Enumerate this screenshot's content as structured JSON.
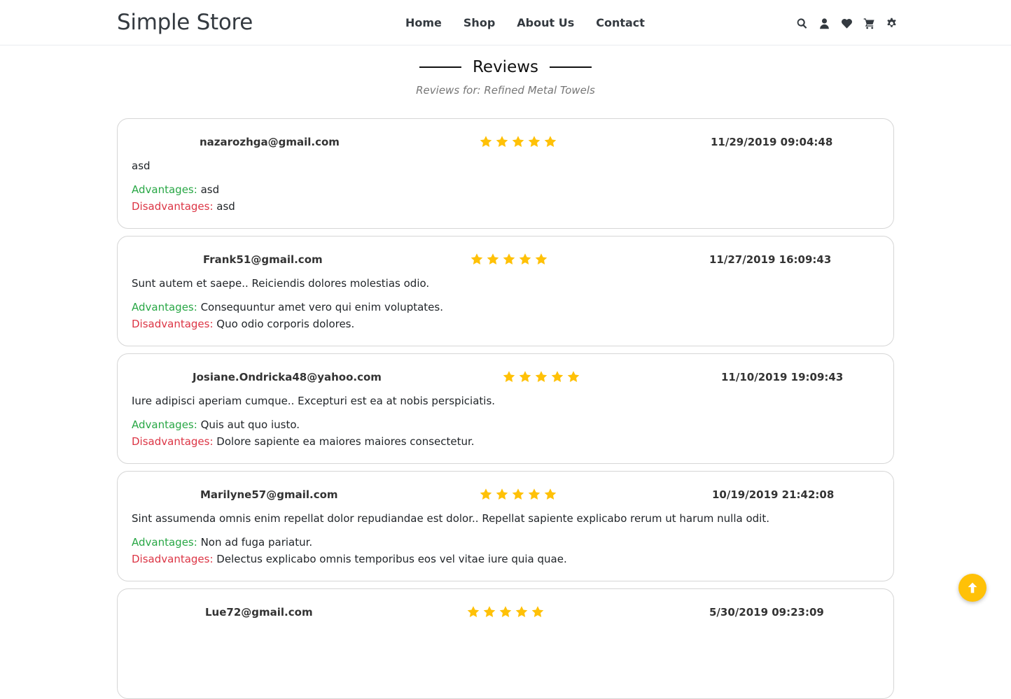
{
  "header": {
    "brand": "Simple Store",
    "nav": [
      "Home",
      "Shop",
      "About Us",
      "Contact"
    ],
    "icons": [
      "search-icon",
      "user-icon",
      "heart-icon",
      "cart-icon",
      "gear-icon"
    ]
  },
  "page": {
    "title": "Reviews",
    "subtitle": "Reviews for: Refined Metal Towels"
  },
  "labels": {
    "advantages": "Advantages:",
    "disadvantages": "Disadvantages:"
  },
  "colors": {
    "accent": "#ffc107",
    "advantages": "#28a745",
    "disadvantages": "#dc3545"
  },
  "reviews": [
    {
      "email": "nazarozhga@gmail.com",
      "rating": 5,
      "date": "11/29/2019 09:04:48",
      "text": "asd",
      "advantages": "asd",
      "disadvantages": "asd"
    },
    {
      "email": "Frank51@gmail.com",
      "rating": 5,
      "date": "11/27/2019 16:09:43",
      "text": "Sunt autem et saepe.. Reiciendis dolores molestias odio.",
      "advantages": "Consequuntur amet vero qui enim voluptates.",
      "disadvantages": "Quo odio corporis dolores."
    },
    {
      "email": "Josiane.Ondricka48@yahoo.com",
      "rating": 5,
      "date": "11/10/2019 19:09:43",
      "text": "Iure adipisci aperiam cumque.. Excepturi est ea at nobis perspiciatis.",
      "advantages": "Quis aut quo iusto.",
      "disadvantages": "Dolore sapiente ea maiores maiores consectetur."
    },
    {
      "email": "Marilyne57@gmail.com",
      "rating": 5,
      "date": "10/19/2019 21:42:08",
      "text": "Sint assumenda omnis enim repellat dolor repudiandae est dolor.. Repellat sapiente explicabo rerum ut harum nulla odit.",
      "advantages": "Non ad fuga pariatur.",
      "disadvantages": "Delectus explicabo omnis temporibus eos vel vitae iure quia quae."
    },
    {
      "email": "Lue72@gmail.com",
      "rating": 5,
      "date": "5/30/2019 09:23:09",
      "text": "",
      "advantages": "",
      "disadvantages": ""
    }
  ]
}
